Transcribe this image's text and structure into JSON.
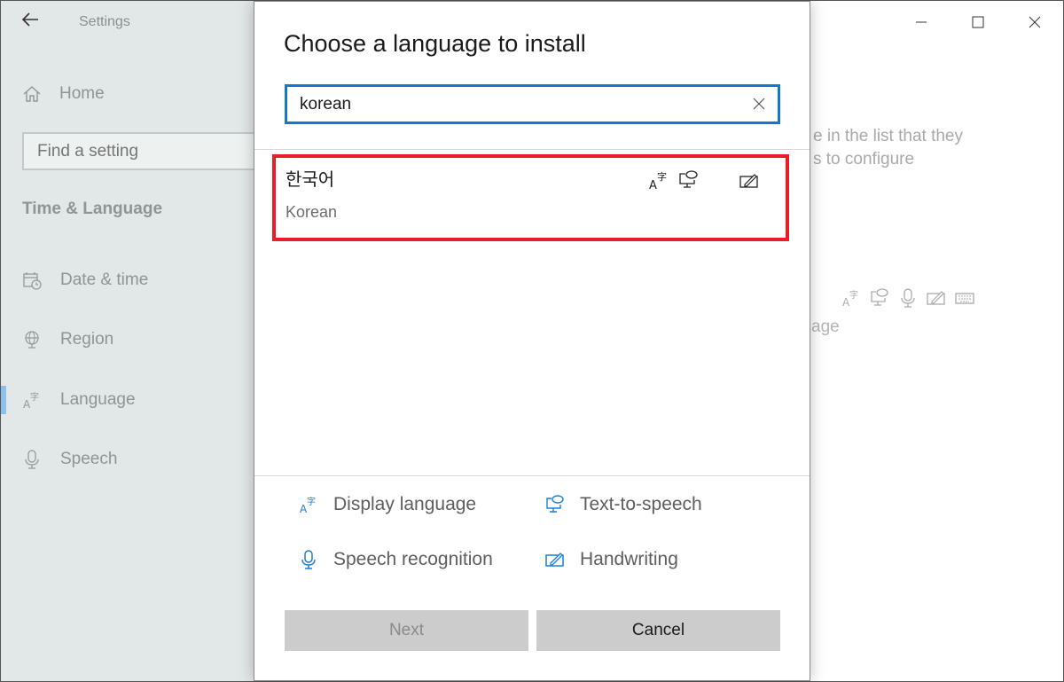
{
  "window": {
    "app_title": "Settings",
    "back_icon": "arrow-left-icon",
    "controls": {
      "minimize_icon": "minimize-icon",
      "maximize_icon": "maximize-icon",
      "close_icon": "close-icon"
    }
  },
  "sidebar": {
    "home": {
      "label": "Home",
      "icon": "home-icon"
    },
    "search": {
      "placeholder": "Find a setting"
    },
    "section_title": "Time & Language",
    "items": [
      {
        "label": "Date & time",
        "icon": "calendar-clock-icon",
        "selected": false
      },
      {
        "label": "Region",
        "icon": "globe-icon",
        "selected": false
      },
      {
        "label": "Language",
        "icon": "language-icon",
        "selected": true
      },
      {
        "label": "Speech",
        "icon": "microphone-icon",
        "selected": false
      }
    ]
  },
  "background_content": {
    "desc_line1": "e in the list that they",
    "desc_line2": "s to configure",
    "partial_text": "age",
    "feature_icons": [
      "display-language-icon",
      "text-to-speech-icon",
      "microphone-icon",
      "handwriting-icon",
      "keyboard-icon"
    ]
  },
  "dialog": {
    "title": "Choose a language to install",
    "search": {
      "value": "korean",
      "clear_icon": "close-icon"
    },
    "results": [
      {
        "native_name": "한국어",
        "english_name": "Korean",
        "highlighted": true,
        "features": [
          "display-language",
          "text-to-speech",
          "handwriting"
        ]
      }
    ],
    "legend": [
      {
        "label": "Display language",
        "icon": "display-language-icon"
      },
      {
        "label": "Text-to-speech",
        "icon": "text-to-speech-icon"
      },
      {
        "label": "Speech recognition",
        "icon": "microphone-icon"
      },
      {
        "label": "Handwriting",
        "icon": "handwriting-icon"
      }
    ],
    "buttons": {
      "next": {
        "label": "Next",
        "enabled": false
      },
      "cancel": {
        "label": "Cancel",
        "enabled": true
      }
    }
  },
  "colors": {
    "accent": "#0f78d7",
    "highlight_border": "#e81d25",
    "sidebar_bg": "#e1e8e7",
    "button_bg": "#cccccc"
  }
}
